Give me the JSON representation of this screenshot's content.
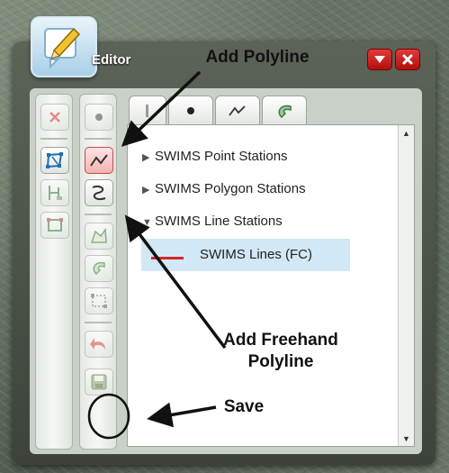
{
  "window": {
    "title": "Editor",
    "icon": "pencil-note-icon",
    "buttons": {
      "minimize": "chevron-down-icon",
      "close": "close-icon"
    }
  },
  "left_toolbar": {
    "items": [
      {
        "name": "clear-selection-icon",
        "state": "dim"
      },
      {
        "name": "select-vertices-icon",
        "state": "normal"
      },
      {
        "name": "attributes-icon",
        "state": "dim"
      },
      {
        "name": "polygon-vertices-icon",
        "state": "dim"
      }
    ]
  },
  "draw_toolbar": {
    "items": [
      {
        "name": "point-icon",
        "state": "dim"
      },
      {
        "name": "polyline-icon",
        "state": "active"
      },
      {
        "name": "freehand-polyline-icon",
        "state": "normal"
      },
      {
        "name": "reshape-icon",
        "state": "dim"
      },
      {
        "name": "cut-icon",
        "state": "dim"
      },
      {
        "name": "extent-icon",
        "state": "dim"
      },
      {
        "name": "undo-icon",
        "state": "dim"
      },
      {
        "name": "save-icon",
        "state": "dim"
      }
    ]
  },
  "tabs": [
    {
      "name": "all-tab-icon"
    },
    {
      "name": "point-tab-icon"
    },
    {
      "name": "polyline-tab-icon"
    },
    {
      "name": "polygon-tab-icon"
    }
  ],
  "layers": [
    {
      "label": "SWIMS Point Stations",
      "expanded": false
    },
    {
      "label": "SWIMS Polygon Stations",
      "expanded": false
    },
    {
      "label": "SWIMS Line Stations",
      "expanded": true,
      "children": [
        {
          "label": "SWIMS Lines (FC)",
          "color": "#d42626"
        }
      ]
    }
  ],
  "annotations": {
    "add_polyline": "Add Polyline",
    "add_freehand_line1": "Add Freehand",
    "add_freehand_line2": "Polyline",
    "save": "Save"
  },
  "colors": {
    "active_tool": "#f4b3b3",
    "close_button": "#d11c1c",
    "selection": "#d2e8f6"
  }
}
